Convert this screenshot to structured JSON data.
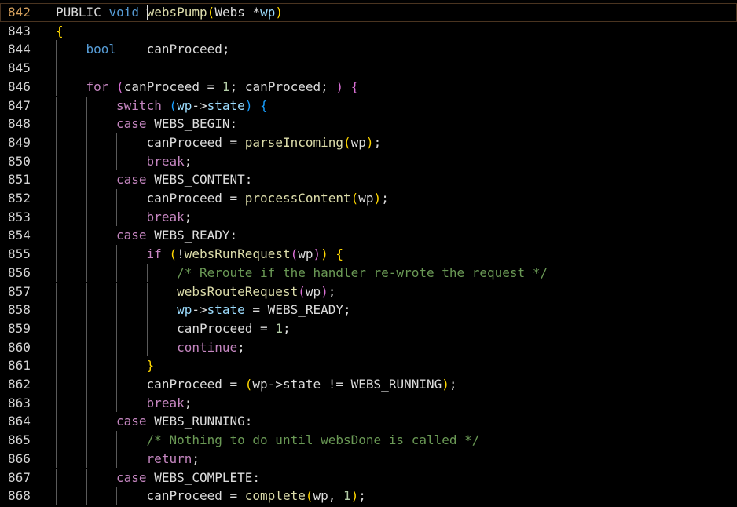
{
  "editor": {
    "current_line": 842,
    "lines": [
      {
        "n": 842,
        "indent": 0,
        "tokens": [
          [
            "PUBLIC ",
            "plain"
          ],
          [
            "void ",
            "kw"
          ],
          [
            "websPump",
            "fn"
          ],
          [
            "(",
            "p1"
          ],
          [
            "Webs ",
            "plain"
          ],
          [
            "*",
            "plain"
          ],
          [
            "wp",
            "var"
          ],
          [
            ")",
            "p1"
          ]
        ]
      },
      {
        "n": 843,
        "indent": 0,
        "tokens": [
          [
            "{",
            "p1"
          ]
        ]
      },
      {
        "n": 844,
        "indent": 1,
        "tokens": [
          [
            "bool",
            "kw"
          ],
          [
            "    canProceed;",
            "plain"
          ]
        ]
      },
      {
        "n": 845,
        "indent": 0,
        "tokens": []
      },
      {
        "n": 846,
        "indent": 1,
        "tokens": [
          [
            "for ",
            "ctl"
          ],
          [
            "(",
            "p2"
          ],
          [
            "canProceed = ",
            "plain"
          ],
          [
            "1",
            "num"
          ],
          [
            "; canProceed; ",
            "plain"
          ],
          [
            ")",
            "p2"
          ],
          [
            " {",
            "p2"
          ]
        ]
      },
      {
        "n": 847,
        "indent": 2,
        "tokens": [
          [
            "switch ",
            "ctl"
          ],
          [
            "(",
            "p3"
          ],
          [
            "wp",
            "var"
          ],
          [
            "->",
            "plain"
          ],
          [
            "state",
            "var"
          ],
          [
            ")",
            "p3"
          ],
          [
            " {",
            "p3"
          ]
        ]
      },
      {
        "n": 848,
        "indent": 2,
        "tokens": [
          [
            "case ",
            "ctl"
          ],
          [
            "WEBS_BEGIN:",
            "plain"
          ]
        ]
      },
      {
        "n": 849,
        "indent": 3,
        "tokens": [
          [
            "canProceed = ",
            "plain"
          ],
          [
            "parseIncoming",
            "fn"
          ],
          [
            "(",
            "p1"
          ],
          [
            "wp",
            "plain"
          ],
          [
            ")",
            "p1"
          ],
          [
            ";",
            "plain"
          ]
        ]
      },
      {
        "n": 850,
        "indent": 3,
        "tokens": [
          [
            "break",
            "ctl"
          ],
          [
            ";",
            "plain"
          ]
        ]
      },
      {
        "n": 851,
        "indent": 2,
        "tokens": [
          [
            "case ",
            "ctl"
          ],
          [
            "WEBS_CONTENT:",
            "plain"
          ]
        ]
      },
      {
        "n": 852,
        "indent": 3,
        "tokens": [
          [
            "canProceed = ",
            "plain"
          ],
          [
            "processContent",
            "fn"
          ],
          [
            "(",
            "p1"
          ],
          [
            "wp",
            "plain"
          ],
          [
            ")",
            "p1"
          ],
          [
            ";",
            "plain"
          ]
        ]
      },
      {
        "n": 853,
        "indent": 3,
        "tokens": [
          [
            "break",
            "ctl"
          ],
          [
            ";",
            "plain"
          ]
        ]
      },
      {
        "n": 854,
        "indent": 2,
        "tokens": [
          [
            "case ",
            "ctl"
          ],
          [
            "WEBS_READY:",
            "plain"
          ]
        ]
      },
      {
        "n": 855,
        "indent": 3,
        "tokens": [
          [
            "if ",
            "ctl"
          ],
          [
            "(",
            "p1"
          ],
          [
            "!",
            "plain"
          ],
          [
            "websRunRequest",
            "fn"
          ],
          [
            "(",
            "p2"
          ],
          [
            "wp",
            "plain"
          ],
          [
            ")",
            "p2"
          ],
          [
            ")",
            "p1"
          ],
          [
            " {",
            "p1"
          ]
        ]
      },
      {
        "n": 856,
        "indent": 4,
        "tokens": [
          [
            "/* Reroute if the handler re-wrote the request */",
            "com"
          ]
        ]
      },
      {
        "n": 857,
        "indent": 4,
        "tokens": [
          [
            "websRouteRequest",
            "fn"
          ],
          [
            "(",
            "p2"
          ],
          [
            "wp",
            "plain"
          ],
          [
            ")",
            "p2"
          ],
          [
            ";",
            "plain"
          ]
        ]
      },
      {
        "n": 858,
        "indent": 4,
        "tokens": [
          [
            "wp",
            "var"
          ],
          [
            "->",
            "plain"
          ],
          [
            "state",
            "var"
          ],
          [
            " = WEBS_READY;",
            "plain"
          ]
        ]
      },
      {
        "n": 859,
        "indent": 4,
        "tokens": [
          [
            "canProceed = ",
            "plain"
          ],
          [
            "1",
            "num"
          ],
          [
            ";",
            "plain"
          ]
        ]
      },
      {
        "n": 860,
        "indent": 4,
        "tokens": [
          [
            "continue",
            "ctl"
          ],
          [
            ";",
            "plain"
          ]
        ]
      },
      {
        "n": 861,
        "indent": 3,
        "tokens": [
          [
            "}",
            "p1"
          ]
        ]
      },
      {
        "n": 862,
        "indent": 3,
        "tokens": [
          [
            "canProceed = ",
            "plain"
          ],
          [
            "(",
            "p1"
          ],
          [
            "wp->state != WEBS_RUNNING",
            "plain"
          ],
          [
            ")",
            "p1"
          ],
          [
            ";",
            "plain"
          ]
        ]
      },
      {
        "n": 863,
        "indent": 3,
        "tokens": [
          [
            "break",
            "ctl"
          ],
          [
            ";",
            "plain"
          ]
        ]
      },
      {
        "n": 864,
        "indent": 2,
        "tokens": [
          [
            "case ",
            "ctl"
          ],
          [
            "WEBS_RUNNING:",
            "plain"
          ]
        ]
      },
      {
        "n": 865,
        "indent": 3,
        "tokens": [
          [
            "/* Nothing to do until websDone is called */",
            "com"
          ]
        ]
      },
      {
        "n": 866,
        "indent": 3,
        "tokens": [
          [
            "return",
            "ctl"
          ],
          [
            ";",
            "plain"
          ]
        ]
      },
      {
        "n": 867,
        "indent": 2,
        "tokens": [
          [
            "case ",
            "ctl"
          ],
          [
            "WEBS_COMPLETE:",
            "plain"
          ]
        ]
      },
      {
        "n": 868,
        "indent": 3,
        "tokens": [
          [
            "canProceed = ",
            "plain"
          ],
          [
            "complete",
            "fn"
          ],
          [
            "(",
            "p1"
          ],
          [
            "wp, ",
            "plain"
          ],
          [
            "1",
            "num"
          ],
          [
            ")",
            "p1"
          ],
          [
            ";",
            "plain"
          ]
        ]
      }
    ]
  }
}
